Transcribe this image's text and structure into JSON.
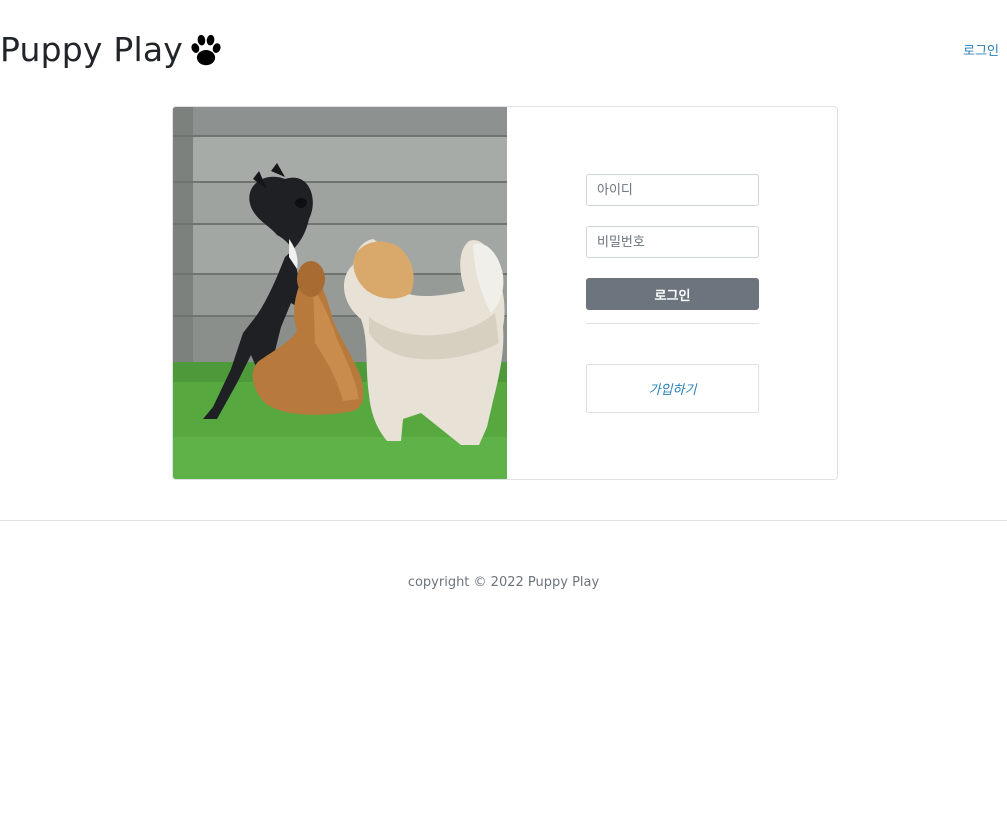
{
  "header": {
    "brand_title": "Puppy Play",
    "nav_login_label": "로그인"
  },
  "login_form": {
    "userid_placeholder": "아이디",
    "password_placeholder": "비밀번호",
    "login_button_label": "로그인",
    "signup_link_label": "가입하기"
  },
  "footer": {
    "copyright": "copyright © 2022 Puppy Play"
  },
  "icons": {
    "brand_icon": "paw-icon"
  },
  "colors": {
    "link": "#2a7fb8",
    "button_bg": "#6c757d",
    "border": "#dee2e6"
  }
}
